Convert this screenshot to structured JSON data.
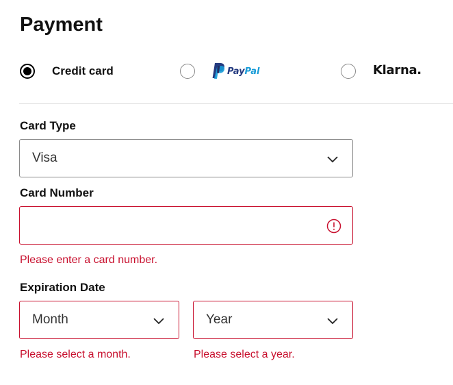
{
  "page": {
    "title": "Payment"
  },
  "payment_methods": {
    "credit_card": {
      "label": "Credit card",
      "selected": true
    },
    "paypal": {
      "logo_text_pay": "Pay",
      "logo_text_pal": "Pal",
      "selected": false
    },
    "klarna": {
      "logo_text": "Klarna.",
      "selected": false
    }
  },
  "card_type": {
    "label": "Card Type",
    "value": "Visa"
  },
  "card_number": {
    "label": "Card Number",
    "value": "",
    "error": "Please enter a card number."
  },
  "expiration": {
    "label": "Expiration Date",
    "month": {
      "value": "Month",
      "error": "Please select a month."
    },
    "year": {
      "value": "Year",
      "error": "Please select a year."
    }
  },
  "colors": {
    "error": "#c8102e",
    "paypal_dark": "#253b80",
    "paypal_light": "#179bd7"
  }
}
